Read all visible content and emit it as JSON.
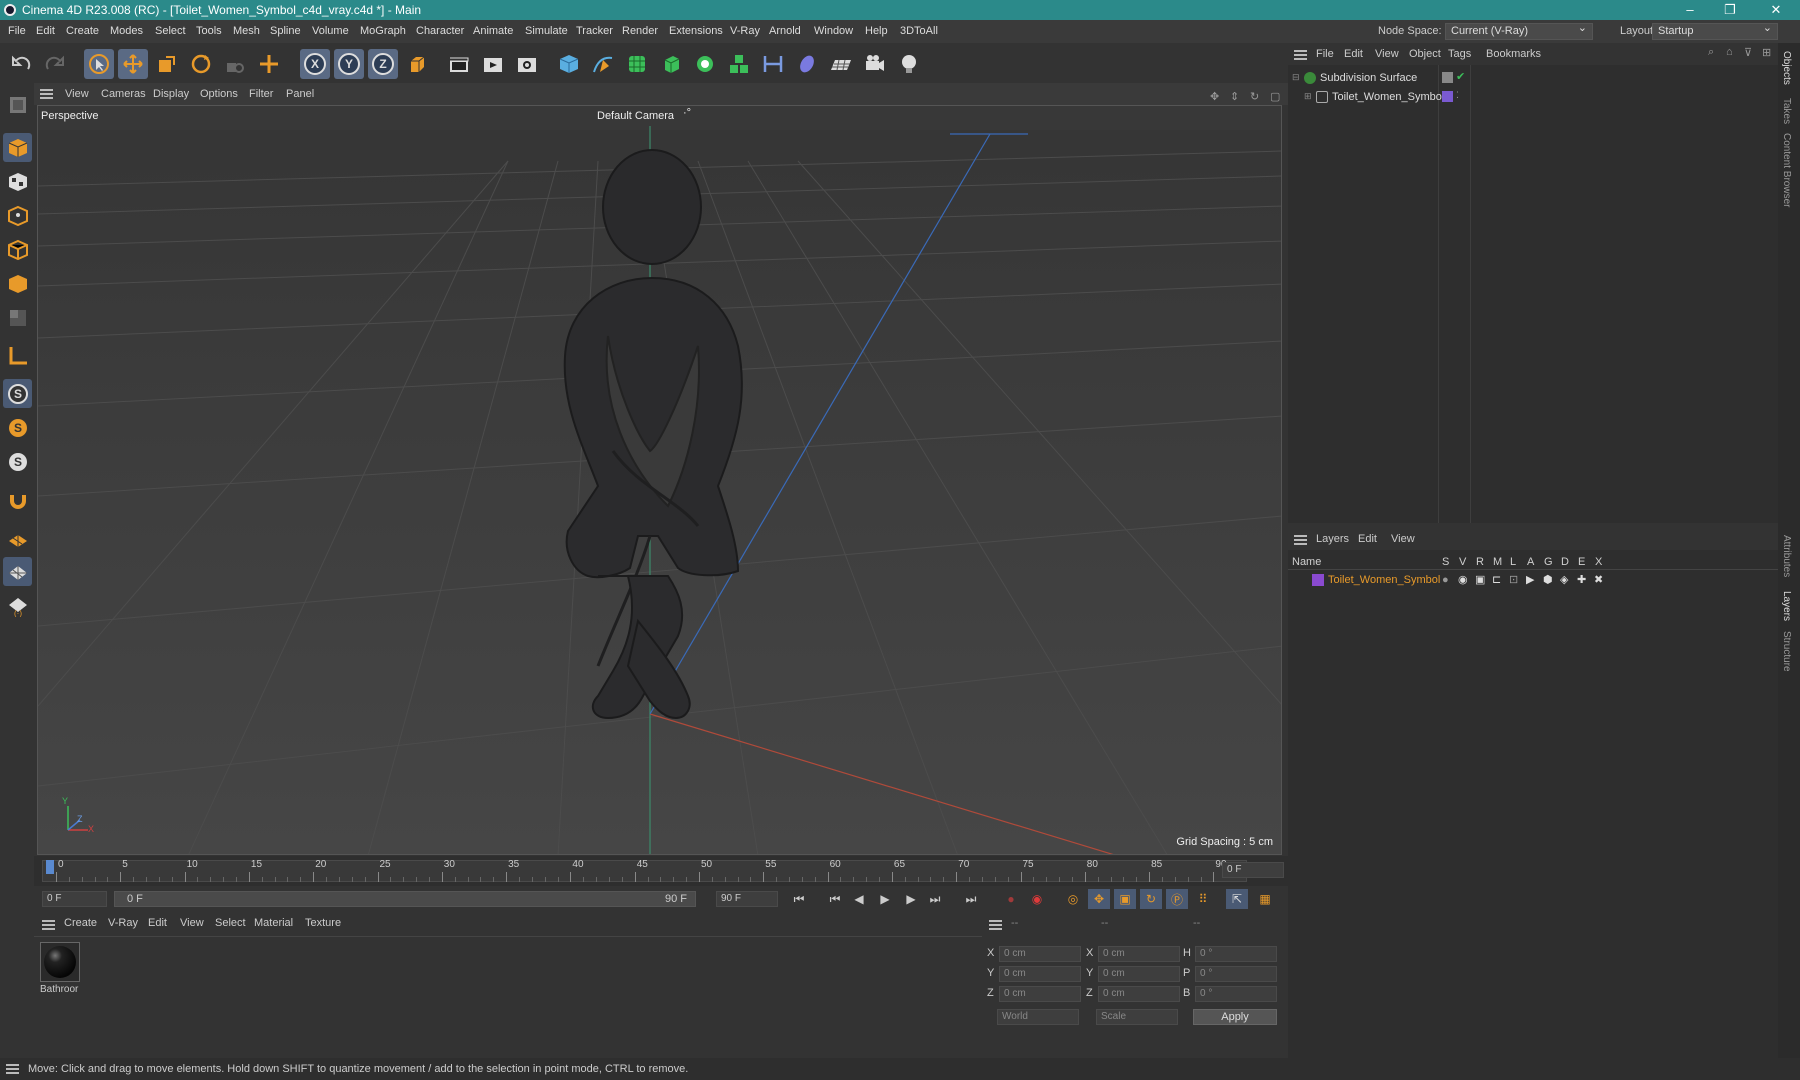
{
  "window": {
    "title": "Cinema 4D R23.008 (RC) - [Toilet_Women_Symbol_c4d_vray.c4d *] - Main",
    "minimize": "–",
    "restore": "❐",
    "close": "✕"
  },
  "menu": {
    "items": [
      "File",
      "Edit",
      "Create",
      "Modes",
      "Select",
      "Tools",
      "Mesh",
      "Spline",
      "Volume",
      "MoGraph",
      "Character",
      "Animate",
      "Simulate",
      "Tracker",
      "Render",
      "Extensions",
      "V-Ray",
      "Arnold",
      "Window",
      "Help",
      "3DToAll"
    ],
    "node_space_label": "Node Space:",
    "node_space_value": "Current (V-Ray)",
    "layout_label": "Layout:",
    "layout_value": "Startup"
  },
  "viewport": {
    "menu": [
      "View",
      "Cameras",
      "Display",
      "Options",
      "Filter",
      "Panel"
    ],
    "projection": "Perspective",
    "camera": "Default Camera",
    "grid_spacing": "Grid Spacing : 5 cm",
    "axis_y": "Y",
    "axis_z": "Z",
    "axis_x": "X"
  },
  "timeline": {
    "ticks": [
      "0",
      "5",
      "10",
      "15",
      "20",
      "25",
      "30",
      "35",
      "40",
      "45",
      "50",
      "55",
      "60",
      "65",
      "70",
      "75",
      "80",
      "85",
      "90"
    ],
    "current_frame_field": "0 F"
  },
  "playback": {
    "start_field": "0 F",
    "range_start": "0 F",
    "range_end": "90 F",
    "end_field": "90 F"
  },
  "material_manager": {
    "menu": [
      "Create",
      "V-Ray",
      "Edit",
      "View",
      "Select",
      "Material",
      "Texture"
    ],
    "materials": [
      {
        "name": "Bathroor"
      }
    ]
  },
  "coordinates": {
    "header": [
      "--",
      "--",
      "--"
    ],
    "rows": [
      {
        "a": "X",
        "av": "0 cm",
        "b": "X",
        "bv": "0 cm",
        "c": "H",
        "cv": "0 °"
      },
      {
        "a": "Y",
        "av": "0 cm",
        "b": "Y",
        "bv": "0 cm",
        "c": "P",
        "cv": "0 °"
      },
      {
        "a": "Z",
        "av": "0 cm",
        "b": "Z",
        "bv": "0 cm",
        "c": "B",
        "cv": "0 °"
      }
    ],
    "mode1": "World",
    "mode2": "Scale",
    "apply": "Apply"
  },
  "object_manager": {
    "menu": [
      "File",
      "Edit",
      "View",
      "Object",
      "Tags",
      "Bookmarks"
    ],
    "objects": [
      {
        "name": "Subdivision Surface",
        "color": "#3a8a3a"
      },
      {
        "name": "Toilet_Women_Symbol",
        "color": "#7a5ad0"
      }
    ]
  },
  "layer_manager": {
    "menu": [
      "Layers",
      "Edit",
      "View"
    ],
    "columns": [
      "Name",
      "S",
      "V",
      "R",
      "M",
      "L",
      "A",
      "G",
      "D",
      "E",
      "X"
    ],
    "layers": [
      {
        "name": "Toilet_Women_Symbol",
        "color": "#8a4ad0"
      }
    ]
  },
  "right_tabs": [
    "Objects",
    "Takes",
    "Content Browser",
    "Attributes",
    "Layers",
    "Structure"
  ],
  "status": "Move: Click and drag to move elements. Hold down SHIFT to quantize movement / add to the selection in point mode, CTRL to remove."
}
